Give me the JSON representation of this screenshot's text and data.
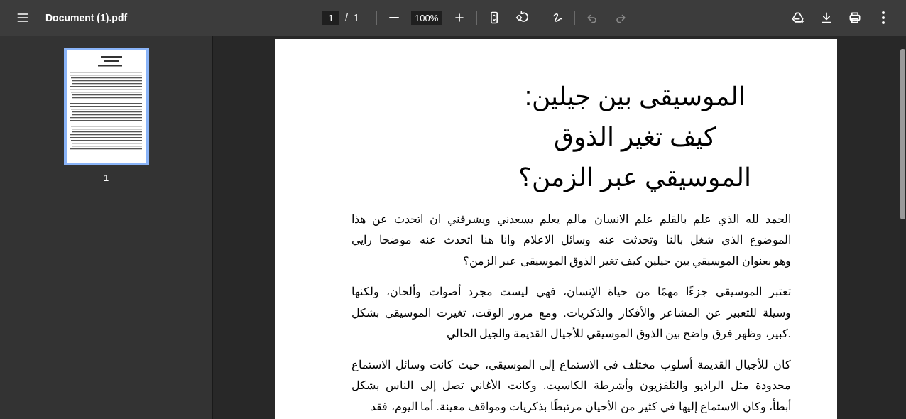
{
  "toolbar": {
    "title": "Document (1).pdf",
    "page_input": "1",
    "page_separator": "/",
    "page_count": "1",
    "zoom_value": "100%",
    "undo_disabled": true,
    "redo_disabled": true
  },
  "sidebar": {
    "thumbnails": [
      {
        "label": "1",
        "selected": true
      }
    ]
  },
  "document": {
    "title_lines": [
      "الموسيقى بين جيلين:",
      "كيف تغير الذوق",
      "الموسيقي عبر الزمن؟"
    ],
    "paragraphs": [
      [
        "الحمد لله الذي علم بالقلم علم الانسان مالم يعلم يسعدني ويشرفني ان اتحدث عن هذا",
        "الموضوع الذي شغل بالنا وتحدثت عنه وسائل الاعلام وانا هنا اتحدث عنه موضحا رايي",
        "وهو بعنوان الموسيقي بين جيلين كيف تغير الذوق الموسيقى عبر الزمن؟"
      ],
      [
        "تعتبر الموسيقى جزءًا مهمًا من حياة الإنسان، فهي ليست مجرد أصوات وألحان، ولكنها",
        "وسيلة للتعبير عن المشاعر والأفكار والذكريات. ومع مرور الوقت، تغيرت الموسيقى بشكل",
        ".كبير، وظهر فرق واضح بين الذوق الموسيقي للأجيال القديمة والجيل الحالي"
      ],
      [
        "كان للأجيال القديمة أسلوب مختلف في الاستماع إلى الموسيقى، حيث كانت وسائل الاستماع",
        "محدودة مثل الراديو والتلفزيون وأشرطة الكاسيت. وكانت الأغاني تصل إلى الناس بشكل",
        "أبطأ، وكان الاستماع إليها في كثير من الأحيان مرتبطًا بذكريات ومواقف معينة. أما اليوم، فقد"
      ]
    ]
  }
}
